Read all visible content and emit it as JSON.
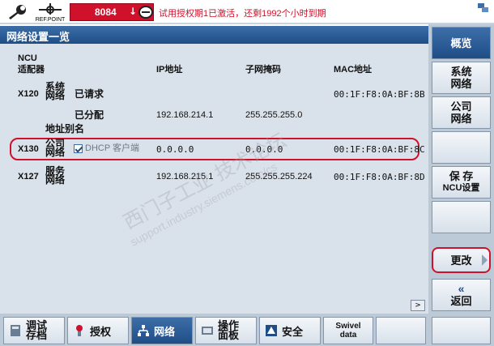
{
  "status_bar": {
    "refpoint_label": "REF.POINT",
    "alarm_code": "8084",
    "alarm_arrow": "↓",
    "message": "试用授权期1已激活，还剩1992个小时到期"
  },
  "title": "网络设置一览",
  "table": {
    "header_line1": "NCU",
    "header_line2": "适配器",
    "col_ip": "IP地址",
    "col_mask": "子网掩码",
    "col_mac": "MAC地址",
    "rows": [
      {
        "port": "X120",
        "name_line1": "系统",
        "name_line2": "网络",
        "requested_label": "已请求",
        "mac": "00:1F:F8:0A:BF:8B",
        "assigned_label": "已分配",
        "ip": "192.168.214.1",
        "mask": "255.255.255.0",
        "alias_label": "地址别名"
      },
      {
        "port": "X130",
        "name_line1": "公司",
        "name_line2": "网络",
        "dhcp_label": "DHCP 客户端",
        "ip": "0.0.0.0",
        "mask": "0.0.0.0",
        "mac": "00:1F:F8:0A:BF:8C"
      },
      {
        "port": "X127",
        "name_line1": "服务",
        "name_line2": "网络",
        "ip": "192.168.215.1",
        "mask": "255.255.255.224",
        "mac": "00:1F:F8:0A:BF:8D"
      }
    ]
  },
  "right_softkeys": [
    {
      "line1": "概览",
      "line2": ""
    },
    {
      "line1": "系统",
      "line2": "网络"
    },
    {
      "line1": "公司",
      "line2": "网络"
    },
    {
      "line1": "",
      "line2": ""
    },
    {
      "line1": "保 存",
      "line2": "NCU设置"
    },
    {
      "line1": "",
      "line2": ""
    },
    {
      "line1": "更改",
      "line2": ""
    },
    {
      "line1": "«",
      "line2": "返回"
    }
  ],
  "bottom_softkeys": [
    {
      "line1": "调试",
      "line2": "存档",
      "icon": "archive-icon"
    },
    {
      "label": "授权",
      "icon": "license-icon"
    },
    {
      "label": "网络",
      "icon": "network-icon"
    },
    {
      "line1": "操作",
      "line2": "面板",
      "icon": "panel-icon"
    },
    {
      "label": "安全",
      "icon": "security-icon"
    },
    {
      "line1": "Swivel",
      "line2": "data"
    }
  ],
  "scroll_hint": ">",
  "watermark": {
    "main": "西门子工业 技术论坛",
    "url": "support.industry.siemens.com/cs"
  },
  "colors": {
    "title_blue": "#1f4e87",
    "alarm_red": "#d0112b",
    "panel_gray": "#d9e1ea"
  }
}
